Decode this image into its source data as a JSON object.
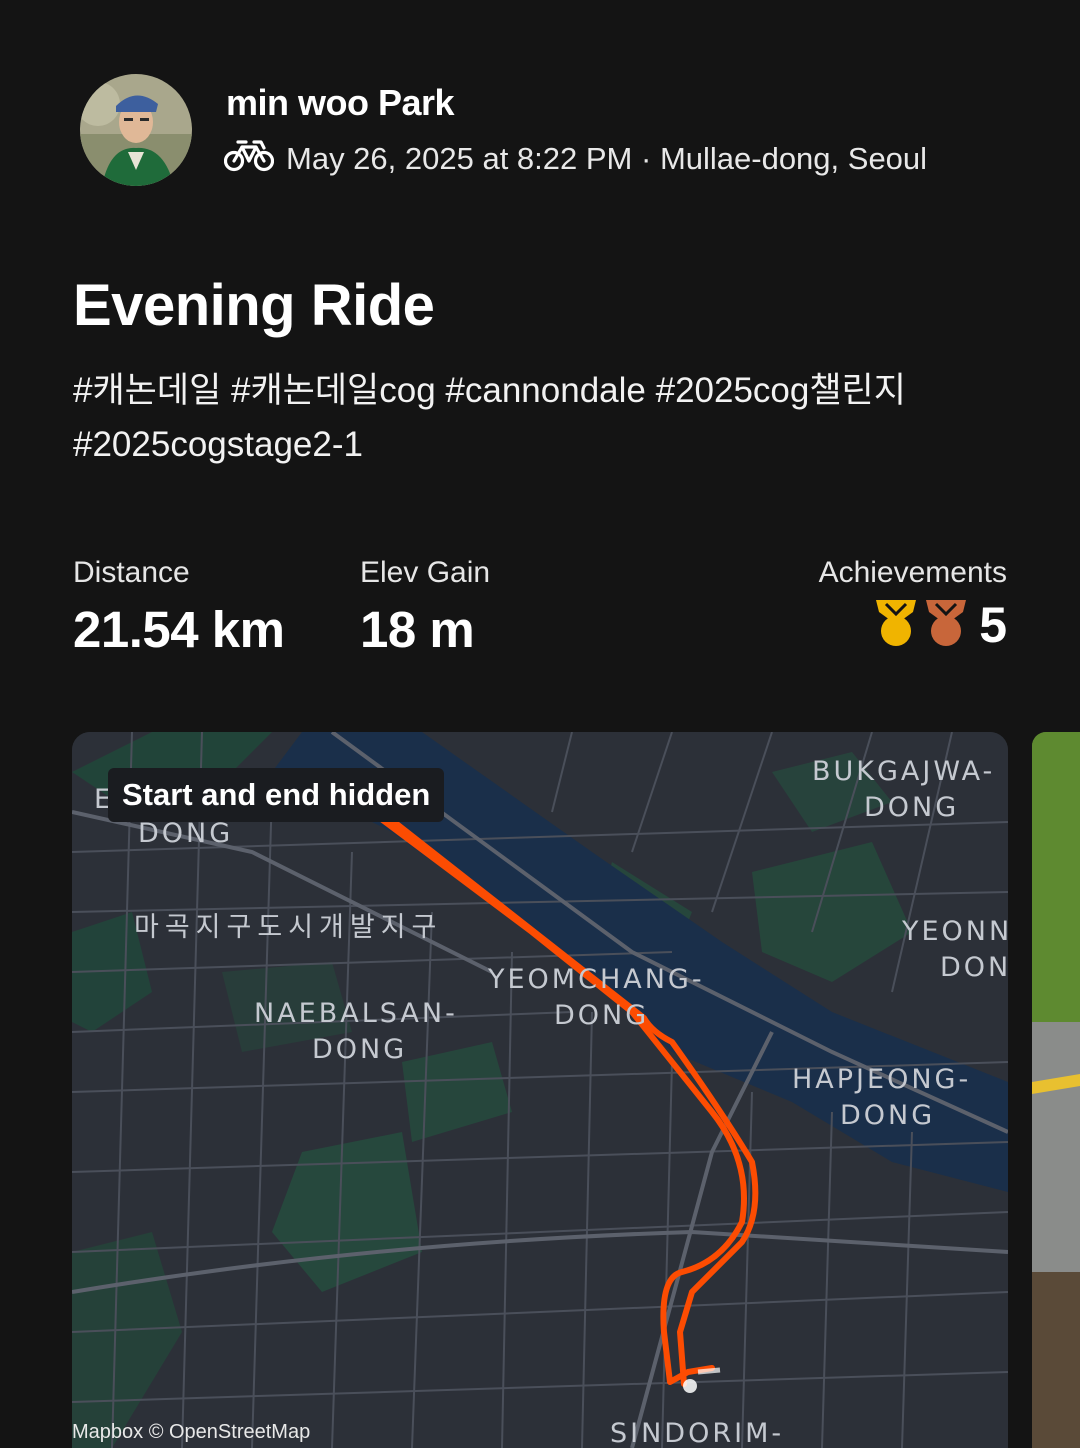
{
  "athlete": {
    "name": "min woo Park",
    "activity_icon": "bike-icon",
    "date": "May 26, 2025 at 8:22 PM",
    "separator": " · ",
    "location": "Mullae-dong, Seoul"
  },
  "activity": {
    "title": "Evening Ride",
    "tags_line1": "#캐논데일 #캐논데일cog #cannondale #2025cog챌린지",
    "tags_line2": "#2025cogstage2-1"
  },
  "stats": {
    "distance_label": "Distance",
    "distance_value": "21.54 km",
    "elev_label": "Elev Gain",
    "elev_value": "18 m",
    "achievements_label": "Achievements",
    "achievements_count": "5",
    "medal_colors": [
      "#f0b400",
      "#c8663a"
    ]
  },
  "map": {
    "badge": "Start and end hidden",
    "attribution": "Mapbox © OpenStreetMap",
    "route_color": "#fc4c02",
    "labels": {
      "e_dong_1": "E",
      "e_dong_2": "DONG",
      "magok": "마곡지구도시개발지구",
      "naebalsan_1": "NAEBALSAN-",
      "naebalsan_2": "DONG",
      "yeomchang_1": "YEOMCHANG-",
      "yeomchang_2": "DONG",
      "bukgajwa_1": "BUKGAJWA-",
      "bukgajwa_2": "DONG",
      "yeonnam_1": "YEONN",
      "yeonnam_2": "DON",
      "hapjeong_1": "HAPJEONG-",
      "hapjeong_2": "DONG",
      "sindorim": "SINDORIM-"
    }
  }
}
